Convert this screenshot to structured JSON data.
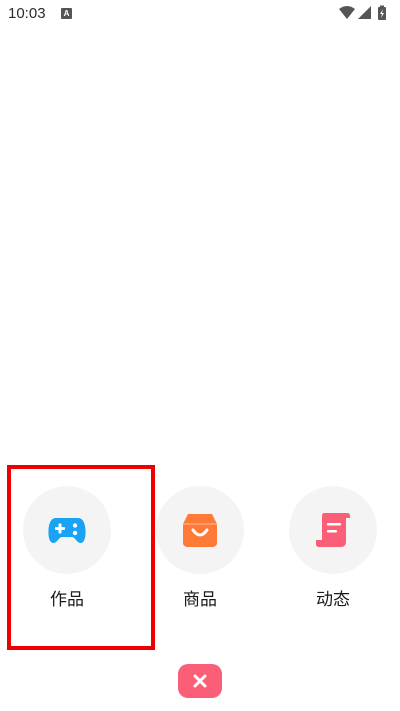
{
  "status_bar": {
    "time": "10:03",
    "notification_icon": "A",
    "icons": [
      "wifi-icon",
      "signal-icon",
      "battery-charging-icon"
    ]
  },
  "share_panel": {
    "options": [
      {
        "label": "作品",
        "icon": "gamepad-icon",
        "color": "#1aa3f5"
      },
      {
        "label": "商品",
        "icon": "shopping-bag-icon",
        "color": "#ff7a36"
      },
      {
        "label": "动态",
        "icon": "scroll-icon",
        "color": "#fb5f77"
      }
    ],
    "close_icon": "close-icon",
    "close_color": "#fb5f77",
    "highlight_color": "#ee0000"
  }
}
